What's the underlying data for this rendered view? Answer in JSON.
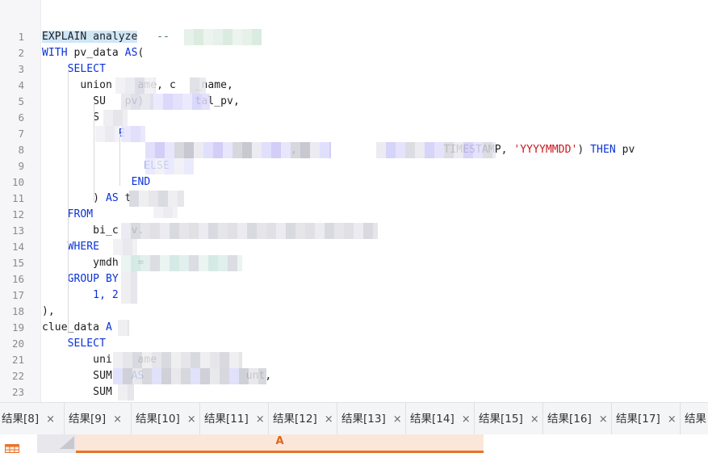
{
  "editor": {
    "line_numbers": [
      "1",
      "2",
      "3",
      "4",
      "5",
      "6",
      "7",
      "8",
      "9",
      "10",
      "11",
      "12",
      "13",
      "14",
      "15",
      "16",
      "17",
      "18",
      "19",
      "20",
      "21",
      "22",
      "23"
    ],
    "lines": [
      {
        "segments": [
          {
            "t": "EXPLAIN analyze",
            "c": "hl"
          },
          {
            "t": "   --",
            "c": "cm"
          }
        ]
      },
      {
        "segments": [
          {
            "t": "WITH",
            "c": "kw"
          },
          {
            "t": " pv_data "
          },
          {
            "t": "AS",
            "c": "kw"
          },
          {
            "t": "("
          }
        ]
      },
      {
        "segments": [
          {
            "t": "    "
          },
          {
            "t": "SELECT",
            "c": "kw"
          }
        ]
      },
      {
        "segments": [
          {
            "t": "      union"
          },
          {
            "t": "    "
          },
          {
            "t": "ame, c"
          },
          {
            "t": "   "
          },
          {
            "t": "_name,"
          }
        ]
      },
      {
        "segments": [
          {
            "t": "        SU"
          },
          {
            "t": "   "
          },
          {
            "t": "pv)"
          },
          {
            "t": "        "
          },
          {
            "t": "tal_pv,"
          }
        ]
      },
      {
        "segments": [
          {
            "t": "        S"
          }
        ]
      },
      {
        "segments": [
          {
            "t": "          "
          },
          {
            "t": "  E",
            "c": "kw"
          }
        ]
      },
      {
        "segments": [
          {
            "t": "                                       "
          },
          {
            "t": ", "
          },
          {
            "t": "  "
          },
          {
            "t": "                    "
          },
          {
            "t": "TIMESTAMP",
            "c": "fn"
          },
          {
            "t": ", "
          },
          {
            "t": "'YYYYMMDD'",
            "c": "str"
          },
          {
            "t": ") "
          },
          {
            "t": "THEN",
            "c": "kw"
          },
          {
            "t": " pv"
          }
        ]
      },
      {
        "segments": [
          {
            "t": "                "
          },
          {
            "t": "ELSE",
            "c": "kw"
          }
        ]
      },
      {
        "segments": [
          {
            "t": "              "
          },
          {
            "t": "END",
            "c": "kw"
          }
        ]
      },
      {
        "segments": [
          {
            "t": "        ) "
          },
          {
            "t": "AS",
            "c": "kw"
          },
          {
            "t": " t"
          }
        ]
      },
      {
        "segments": [
          {
            "t": "    "
          },
          {
            "t": "FROM",
            "c": "kw"
          }
        ]
      },
      {
        "segments": [
          {
            "t": "        bi_c"
          },
          {
            "t": "  "
          },
          {
            "t": "v."
          }
        ]
      },
      {
        "segments": [
          {
            "t": "    "
          },
          {
            "t": "WHERE",
            "c": "kw"
          }
        ]
      },
      {
        "segments": [
          {
            "t": "        ymdh"
          },
          {
            "t": "   "
          },
          {
            "t": "="
          }
        ]
      },
      {
        "segments": [
          {
            "t": "    "
          },
          {
            "t": "GROUP BY",
            "c": "kw"
          }
        ]
      },
      {
        "segments": [
          {
            "t": "        1, 2",
            "c": "kw"
          }
        ]
      },
      {
        "segments": [
          {
            "t": "),"
          }
        ]
      },
      {
        "segments": [
          {
            "t": "clue_data "
          },
          {
            "t": "A",
            "c": "kw"
          }
        ]
      },
      {
        "segments": [
          {
            "t": "    "
          },
          {
            "t": "SELECT",
            "c": "kw"
          }
        ]
      },
      {
        "segments": [
          {
            "t": "        uni"
          },
          {
            "t": "    "
          },
          {
            "t": "ame"
          }
        ]
      },
      {
        "segments": [
          {
            "t": "        SUM"
          },
          {
            "t": "   "
          },
          {
            "t": "AS",
            "c": "kw"
          },
          {
            "t": "                "
          },
          {
            "t": "unt,"
          }
        ]
      },
      {
        "segments": [
          {
            "t": "        SUM"
          }
        ]
      }
    ]
  },
  "result_tabs": [
    {
      "label": "结果[8]",
      "close": "×"
    },
    {
      "label": "结果[9]",
      "close": "×"
    },
    {
      "label": "结果[10]",
      "close": "×"
    },
    {
      "label": "结果[11]",
      "close": "×"
    },
    {
      "label": "结果[12]",
      "close": "×"
    },
    {
      "label": "结果[13]",
      "close": "×"
    },
    {
      "label": "结果[14]",
      "close": "×"
    },
    {
      "label": "结果[15]",
      "close": "×"
    },
    {
      "label": "结果[16]",
      "close": "×"
    },
    {
      "label": "结果[17]",
      "close": "×"
    },
    {
      "label": "结果",
      "close": ""
    }
  ],
  "grid": {
    "column_a": "A",
    "icon": "table-grid-icon",
    "accent": "#e8742a"
  }
}
